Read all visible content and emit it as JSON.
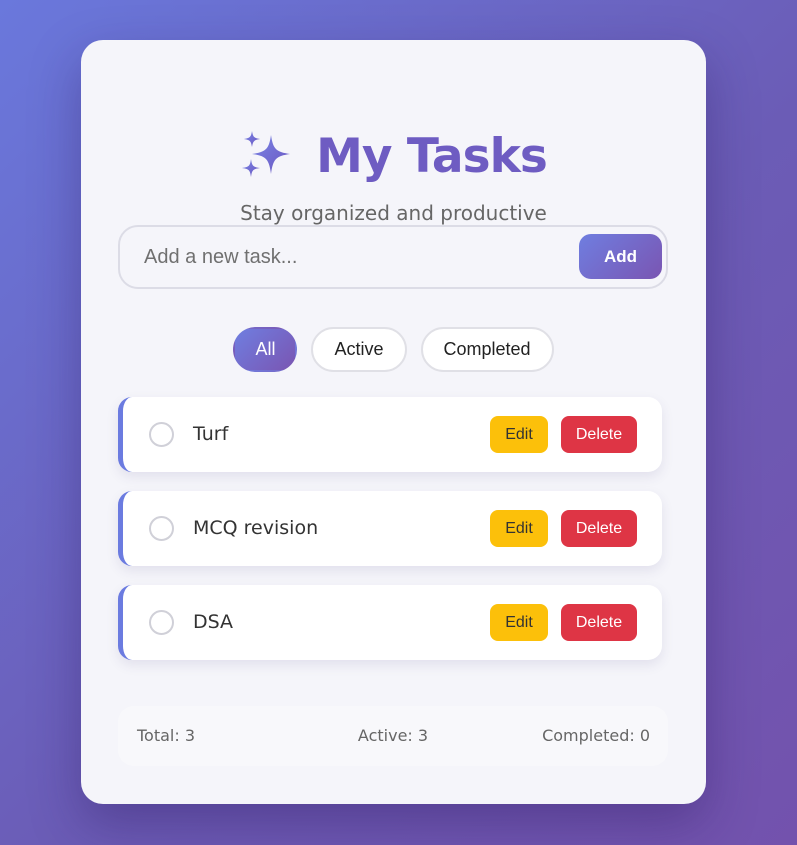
{
  "header": {
    "icon": "sparkles-icon",
    "title": "My Tasks",
    "subtitle": "Stay organized and productive"
  },
  "add_form": {
    "placeholder": "Add a new task...",
    "value": "",
    "add_label": "Add"
  },
  "filters": [
    {
      "label": "All",
      "selected": true
    },
    {
      "label": "Active",
      "selected": false
    },
    {
      "label": "Completed",
      "selected": false
    }
  ],
  "tasks": [
    {
      "text": "Turf",
      "completed": false,
      "edit_label": "Edit",
      "delete_label": "Delete"
    },
    {
      "text": "MCQ revision",
      "completed": false,
      "edit_label": "Edit",
      "delete_label": "Delete"
    },
    {
      "text": "DSA",
      "completed": false,
      "edit_label": "Edit",
      "delete_label": "Delete"
    }
  ],
  "stats": {
    "total": "Total: 3",
    "active": "Active: 3",
    "completed": "Completed: 0"
  },
  "colors": {
    "accent": "#6e5cc2",
    "edit_button": "#fcc00a",
    "delete_button": "#de3545",
    "task_border": "#6b7be0"
  }
}
